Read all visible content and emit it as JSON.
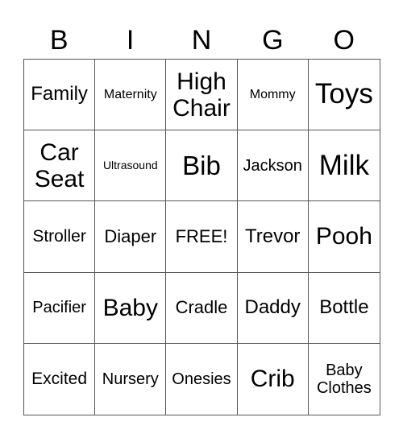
{
  "header": {
    "letters": [
      "B",
      "I",
      "N",
      "G",
      "O"
    ]
  },
  "cells": [
    "Family",
    "Maternity",
    "High\nChair",
    "Mommy",
    "Toys",
    "Car\nSeat",
    "Ultrasound",
    "Bib",
    "Jackson",
    "Milk",
    "Stroller",
    "Diaper",
    "FREE!",
    "Trevor",
    "Pooh",
    "Pacifier",
    "Baby",
    "Cradle",
    "Daddy",
    "Bottle",
    "Excited",
    "Nursery",
    "Onesies",
    "Crib",
    "Baby\nClothes"
  ]
}
